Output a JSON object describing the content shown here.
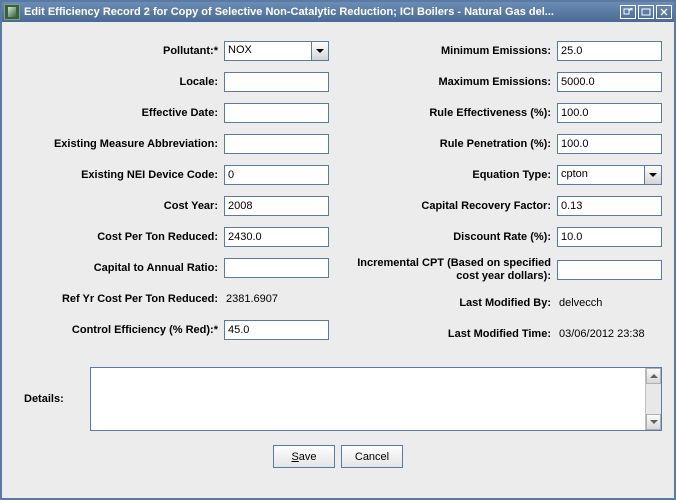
{
  "window": {
    "title": "Edit Efficiency Record 2 for Copy of Selective Non-Catalytic Reduction; ICI Boilers - Natural Gas del..."
  },
  "left": {
    "pollutant_label": "Pollutant:*",
    "pollutant_value": "NOX",
    "locale_label": "Locale:",
    "locale_value": "",
    "effective_date_label": "Effective Date:",
    "effective_date_value": "",
    "existing_measure_abbrev_label": "Existing Measure Abbreviation:",
    "existing_measure_abbrev_value": "",
    "existing_nei_device_code_label": "Existing NEI Device Code:",
    "existing_nei_device_code_value": "0",
    "cost_year_label": "Cost Year:",
    "cost_year_value": "2008",
    "cost_per_ton_reduced_label": "Cost Per Ton Reduced:",
    "cost_per_ton_reduced_value": "2430.0",
    "capital_to_annual_ratio_label": "Capital to Annual Ratio:",
    "capital_to_annual_ratio_value": "",
    "ref_yr_cost_per_ton_label": "Ref Yr Cost Per Ton Reduced:",
    "ref_yr_cost_per_ton_value": "2381.6907",
    "control_efficiency_label": "Control Efficiency (% Red):*",
    "control_efficiency_value": "45.0"
  },
  "right": {
    "min_emissions_label": "Minimum Emissions:",
    "min_emissions_value": "25.0",
    "max_emissions_label": "Maximum Emissions:",
    "max_emissions_value": "5000.0",
    "rule_effectiveness_label": "Rule Effectiveness (%):",
    "rule_effectiveness_value": "100.0",
    "rule_penetration_label": "Rule Penetration (%):",
    "rule_penetration_value": "100.0",
    "equation_type_label": "Equation Type:",
    "equation_type_value": "cpton",
    "capital_recovery_factor_label": "Capital Recovery Factor:",
    "capital_recovery_factor_value": "0.13",
    "discount_rate_label": "Discount Rate (%):",
    "discount_rate_value": "10.0",
    "incremental_cpt_label": "Incremental CPT (Based on specified cost year dollars):",
    "incremental_cpt_value": "",
    "last_modified_by_label": "Last Modified By:",
    "last_modified_by_value": "delvecch",
    "last_modified_time_label": "Last Modified Time:",
    "last_modified_time_value": "03/06/2012 23:38"
  },
  "details": {
    "label": "Details:",
    "value": ""
  },
  "buttons": {
    "save_mnemonic": "S",
    "save_rest": "ave",
    "cancel": "Cancel"
  }
}
